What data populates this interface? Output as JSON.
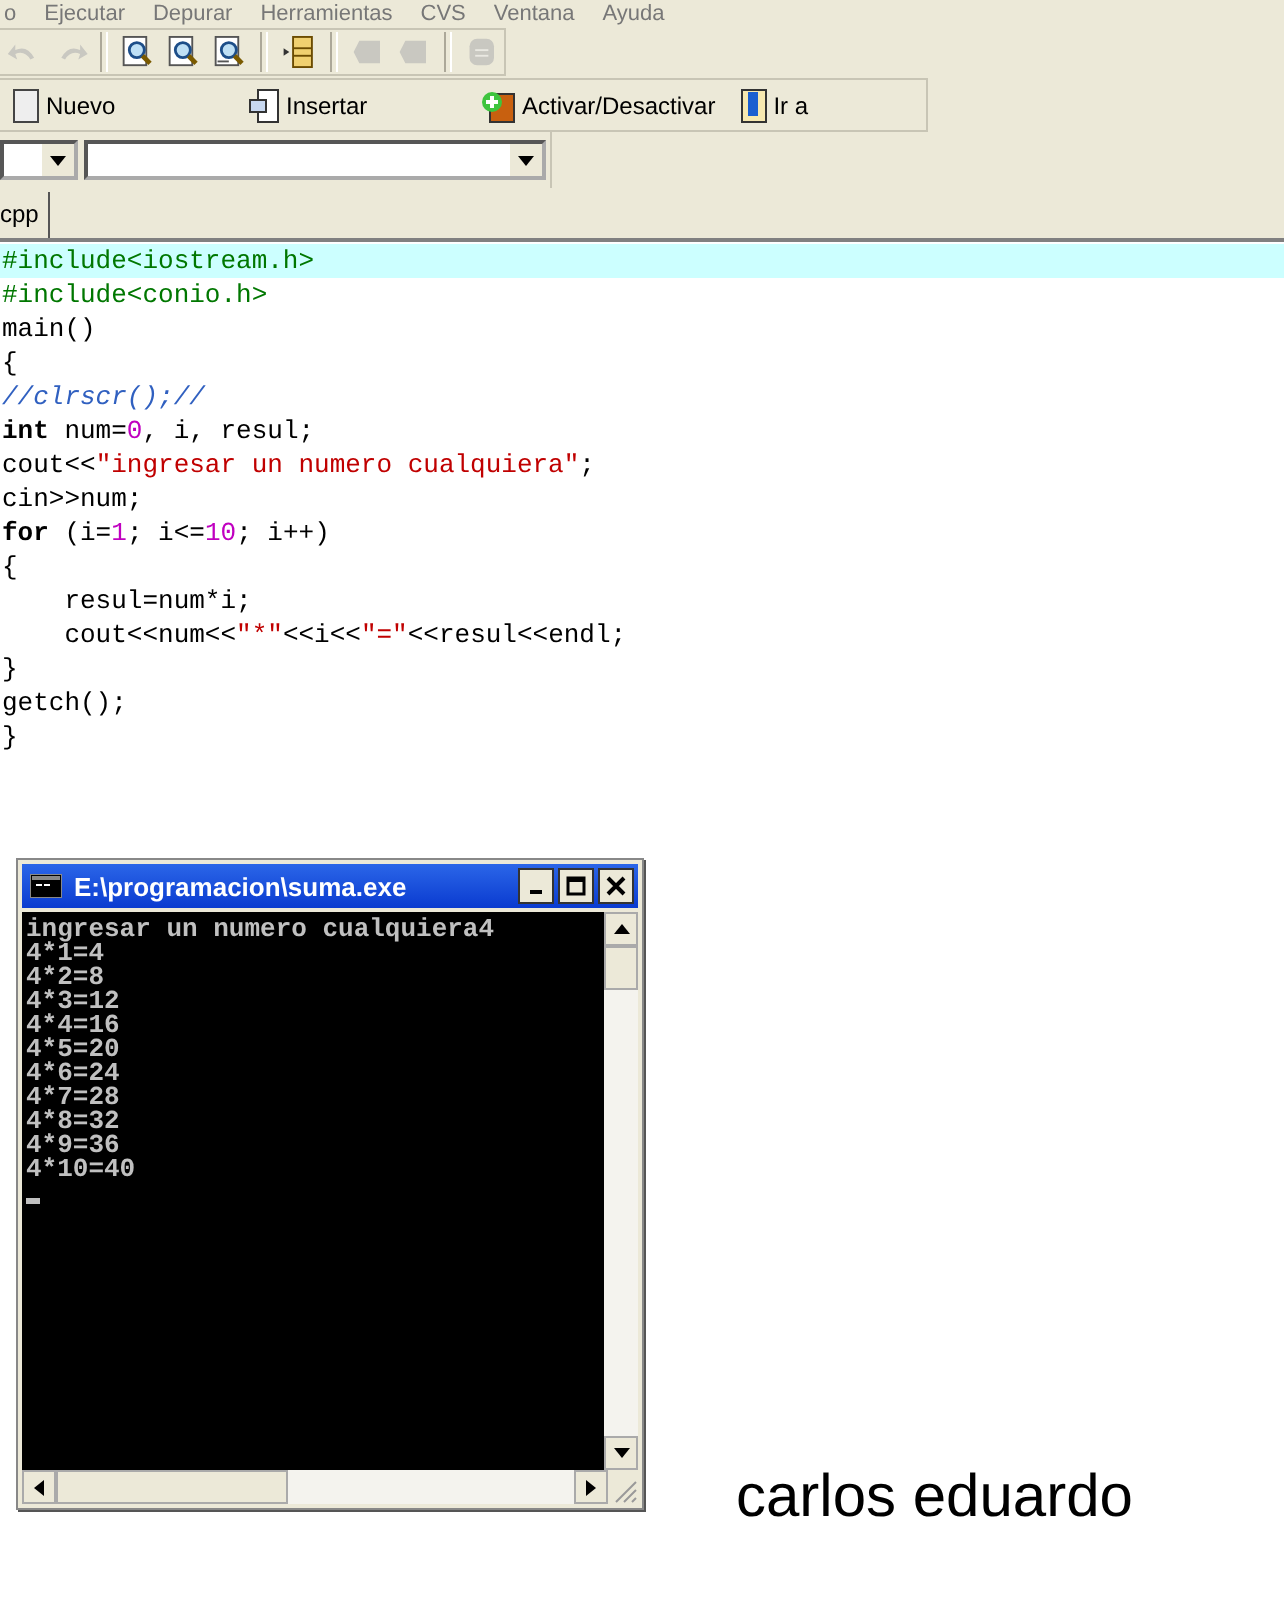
{
  "menu": [
    "o",
    "Ejecutar",
    "Depurar",
    "Herramientas",
    "CVS",
    "Ventana",
    "Ayuda"
  ],
  "toolbar": [
    {
      "kind": "undo",
      "disabled": true
    },
    {
      "kind": "redo",
      "disabled": true
    },
    {
      "kind": "sep"
    },
    {
      "kind": "find",
      "disabled": false
    },
    {
      "kind": "find",
      "disabled": false
    },
    {
      "kind": "find-replace",
      "disabled": false
    },
    {
      "kind": "sep"
    },
    {
      "kind": "goto-line",
      "disabled": false
    },
    {
      "kind": "sep"
    },
    {
      "kind": "bookmark-prev",
      "disabled": true
    },
    {
      "kind": "bookmark-next",
      "disabled": true
    },
    {
      "kind": "sep"
    },
    {
      "kind": "list",
      "disabled": true
    }
  ],
  "bookmark_bar": [
    {
      "label": "Nuevo",
      "kind": "new"
    },
    {
      "label": "Insertar",
      "kind": "insert"
    },
    {
      "label": "Activar/Desactivar",
      "kind": "toggle"
    },
    {
      "label": "Ir a",
      "kind": "goto"
    }
  ],
  "tabs": [
    {
      "label": "cpp",
      "selected": true
    }
  ],
  "editor": {
    "lines": [
      {
        "highlighted": true,
        "tokens": [
          {
            "kind": "preproc",
            "text": "#include<iostream.h>"
          }
        ]
      },
      {
        "highlighted": false,
        "tokens": [
          {
            "kind": "preproc",
            "text": "#include<conio.h>"
          }
        ]
      },
      {
        "highlighted": false,
        "tokens": [
          {
            "kind": "plain",
            "text": "main()"
          }
        ]
      },
      {
        "highlighted": false,
        "tokens": [
          {
            "kind": "plain",
            "text": "{"
          }
        ]
      },
      {
        "highlighted": false,
        "tokens": [
          {
            "kind": "comment",
            "text": "//clrscr();//"
          }
        ]
      },
      {
        "highlighted": false,
        "tokens": [
          {
            "kind": "keyword",
            "text": "int"
          },
          {
            "kind": "plain",
            "text": " num="
          },
          {
            "kind": "number",
            "text": "0"
          },
          {
            "kind": "plain",
            "text": ", i, resul;"
          }
        ]
      },
      {
        "highlighted": false,
        "tokens": [
          {
            "kind": "plain",
            "text": "cout<<"
          },
          {
            "kind": "string",
            "text": "\"ingresar un numero cualquiera\""
          },
          {
            "kind": "plain",
            "text": ";"
          }
        ]
      },
      {
        "highlighted": false,
        "tokens": [
          {
            "kind": "plain",
            "text": "cin>>num;"
          }
        ]
      },
      {
        "highlighted": false,
        "tokens": [
          {
            "kind": "keyword",
            "text": "for"
          },
          {
            "kind": "plain",
            "text": " (i="
          },
          {
            "kind": "number",
            "text": "1"
          },
          {
            "kind": "plain",
            "text": "; i<="
          },
          {
            "kind": "number",
            "text": "10"
          },
          {
            "kind": "plain",
            "text": "; i++)"
          }
        ]
      },
      {
        "highlighted": false,
        "tokens": [
          {
            "kind": "plain",
            "text": "{"
          }
        ]
      },
      {
        "highlighted": false,
        "tokens": [
          {
            "kind": "plain",
            "text": "    resul=num*i;"
          }
        ]
      },
      {
        "highlighted": false,
        "tokens": [
          {
            "kind": "plain",
            "text": "    cout<<num<<"
          },
          {
            "kind": "string",
            "text": "\"*\""
          },
          {
            "kind": "plain",
            "text": "<<i<<"
          },
          {
            "kind": "string",
            "text": "\"=\""
          },
          {
            "kind": "plain",
            "text": "<<resul<<endl;"
          }
        ]
      },
      {
        "highlighted": false,
        "tokens": [
          {
            "kind": "plain",
            "text": "}"
          }
        ]
      },
      {
        "highlighted": false,
        "tokens": [
          {
            "kind": "plain",
            "text": "getch();"
          }
        ]
      },
      {
        "highlighted": false,
        "tokens": [
          {
            "kind": "plain",
            "text": "}"
          }
        ]
      }
    ]
  },
  "console": {
    "title": "E:\\programacion\\suma.exe",
    "lines": [
      "ingresar un numero cualquiera4",
      "4*1=4",
      "4*2=8",
      "4*3=12",
      "4*4=16",
      "4*5=20",
      "4*6=24",
      "4*7=28",
      "4*8=32",
      "4*9=36",
      "4*10=40"
    ]
  },
  "signature": "carlos eduardo"
}
